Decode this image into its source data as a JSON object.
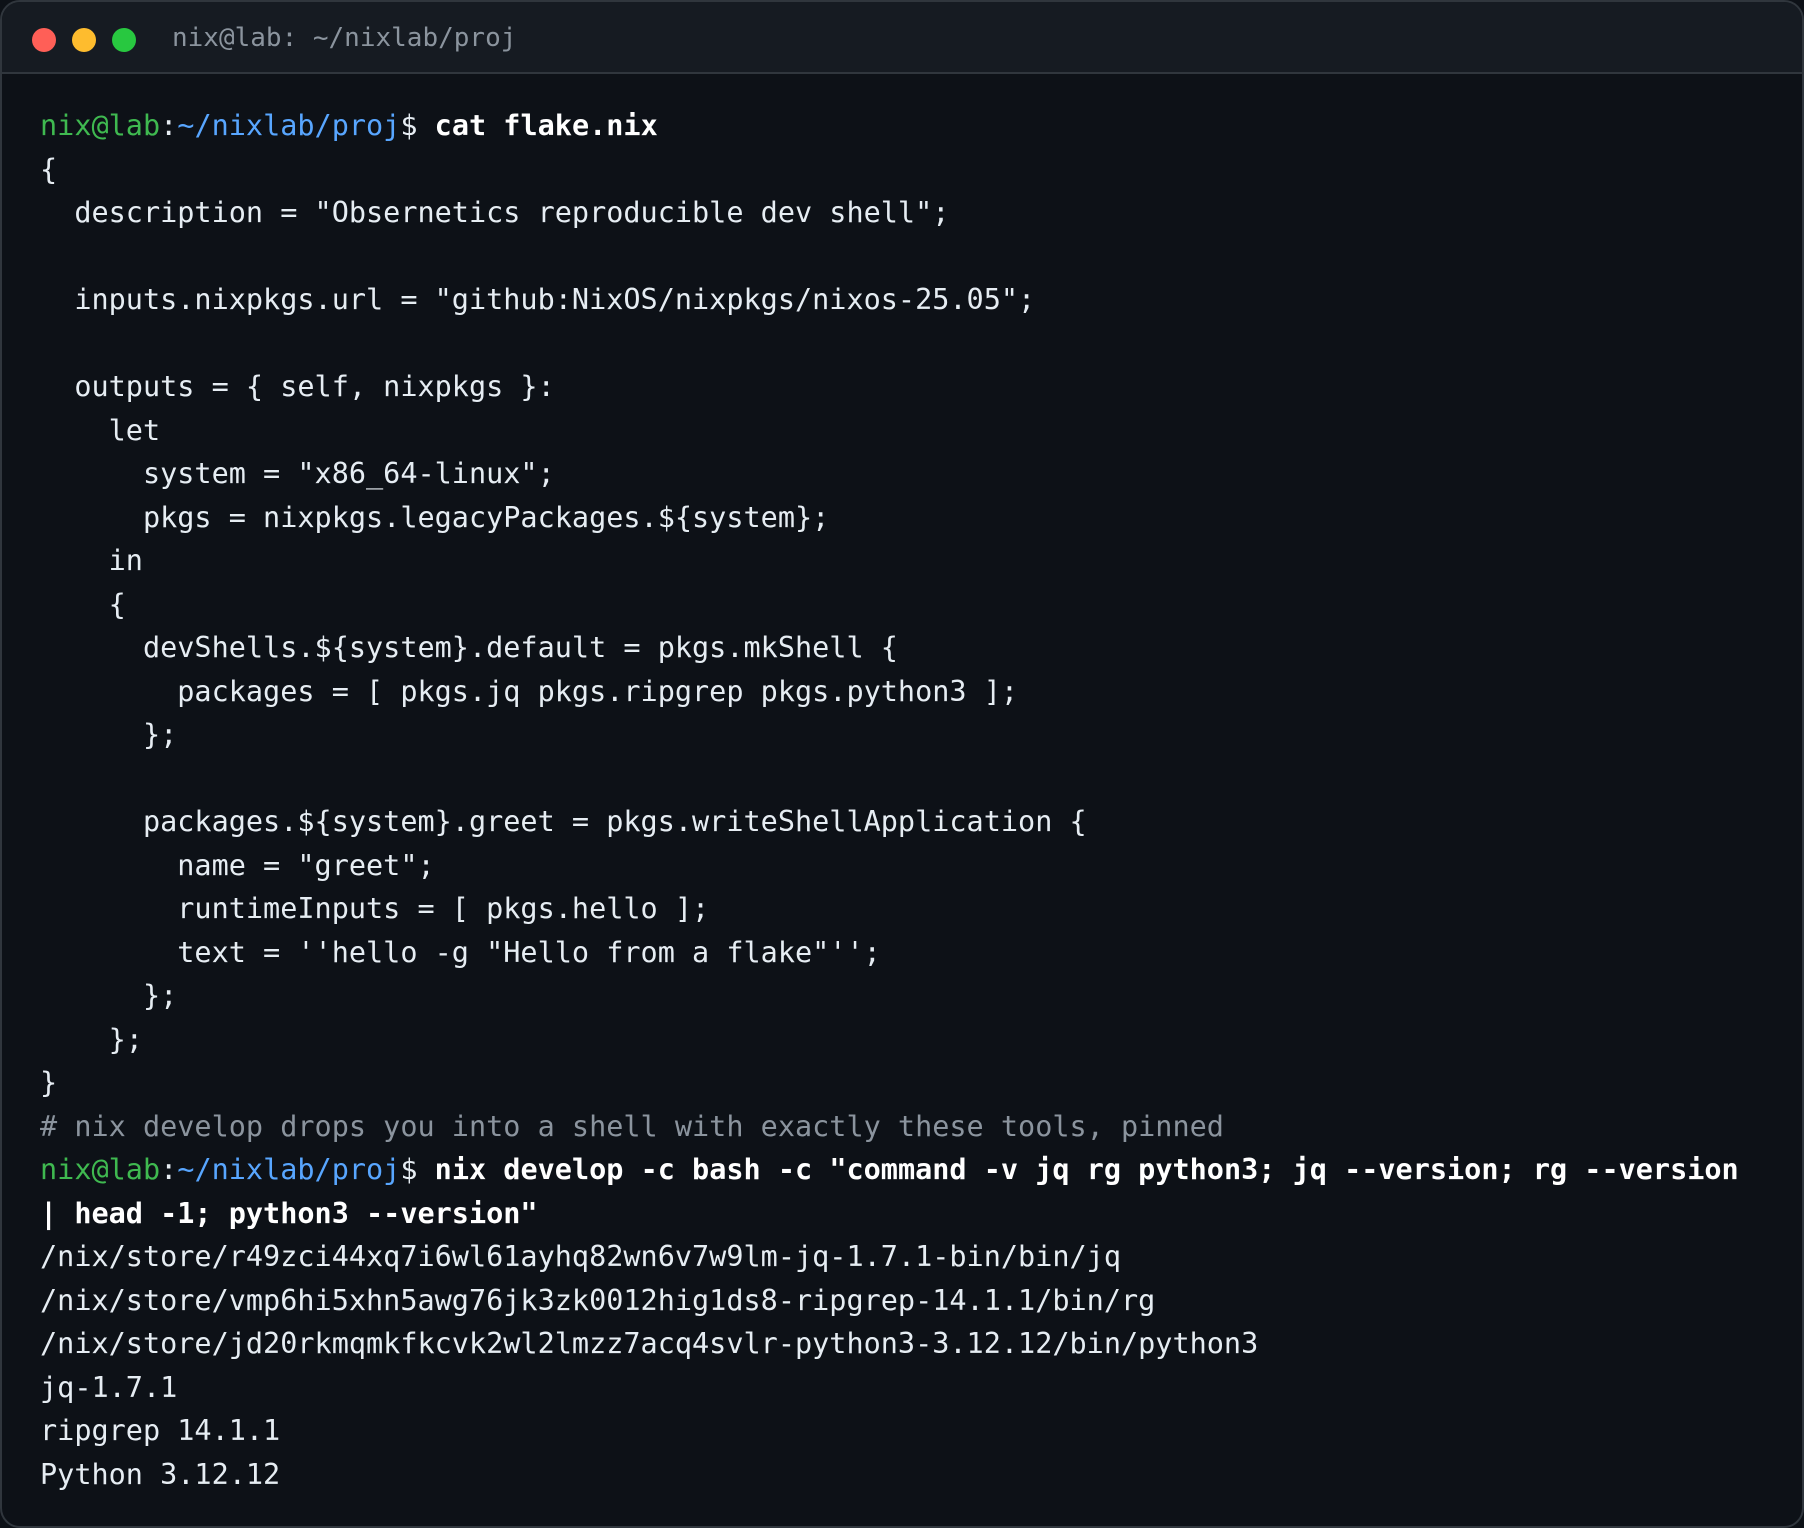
{
  "window": {
    "title": "nix@lab: ~/nixlab/proj",
    "colors": {
      "background": "#0d1117",
      "titlebar": "#161b22",
      "close": "#ff5f57",
      "minimize": "#febc2e",
      "maximize": "#28c840",
      "prompt_user": "#3fb950",
      "prompt_path": "#58a6ff",
      "comment": "#8b949e"
    }
  },
  "prompt": {
    "user": "nix@lab",
    "sep": ":",
    "path": "~/nixlab/proj",
    "dollar": "$ "
  },
  "commands": {
    "first": "cat flake.nix",
    "second": "nix develop -c bash -c \"command -v jq rg python3; jq --version; rg --version | head -1; python3 --version\""
  },
  "flake_lines": [
    "{",
    "  description = \"Obsernetics reproducible dev shell\";",
    "",
    "  inputs.nixpkgs.url = \"github:NixOS/nixpkgs/nixos-25.05\";",
    "",
    "  outputs = { self, nixpkgs }:",
    "    let",
    "      system = \"x86_64-linux\";",
    "      pkgs = nixpkgs.legacyPackages.${system};",
    "    in",
    "    {",
    "      devShells.${system}.default = pkgs.mkShell {",
    "        packages = [ pkgs.jq pkgs.ripgrep pkgs.python3 ];",
    "      };",
    "",
    "      packages.${system}.greet = pkgs.writeShellApplication {",
    "        name = \"greet\";",
    "        runtimeInputs = [ pkgs.hello ];",
    "        text = ''hello -g \"Hello from a flake\"'';",
    "      };",
    "    };",
    "}"
  ],
  "comment": "# nix develop drops you into a shell with exactly these tools, pinned",
  "output_lines": [
    "/nix/store/r49zci44xq7i6wl61ayhq82wn6v7w9lm-jq-1.7.1-bin/bin/jq",
    "/nix/store/vmp6hi5xhn5awg76jk3zk0012hig1ds8-ripgrep-14.1.1/bin/rg",
    "/nix/store/jd20rkmqmkfkcvk2wl2lmzz7acq4svlr-python3-3.12.12/bin/python3",
    "jq-1.7.1",
    "ripgrep 14.1.1",
    "Python 3.12.12"
  ]
}
